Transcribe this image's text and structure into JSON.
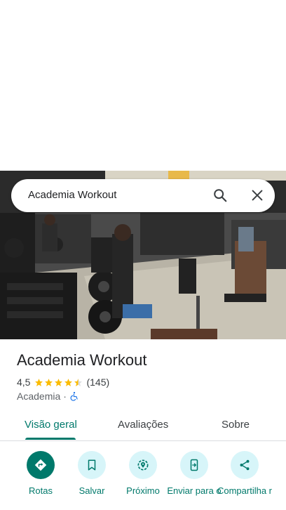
{
  "search": {
    "query": "Academia Workout"
  },
  "place": {
    "name": "Academia Workout",
    "rating": "4,5",
    "stars_filled": 4.5,
    "review_count": "(145)",
    "category": "Academia",
    "separator": "·"
  },
  "tabs": [
    {
      "label": "Visão geral",
      "active": true
    },
    {
      "label": "Avaliações",
      "active": false
    },
    {
      "label": "Sobre",
      "active": false
    }
  ],
  "actions": [
    {
      "label": "Rotas",
      "icon": "directions-icon"
    },
    {
      "label": "Salvar",
      "icon": "bookmark-icon"
    },
    {
      "label": "Próximo",
      "icon": "nearby-icon"
    },
    {
      "label": "Enviar para o",
      "icon": "send-to-phone-icon"
    },
    {
      "label": "Compartilha r",
      "icon": "share-icon"
    }
  ],
  "colors": {
    "accent": "#00796b",
    "star": "#fbbc04",
    "action_bg": "#d7f5f9"
  }
}
